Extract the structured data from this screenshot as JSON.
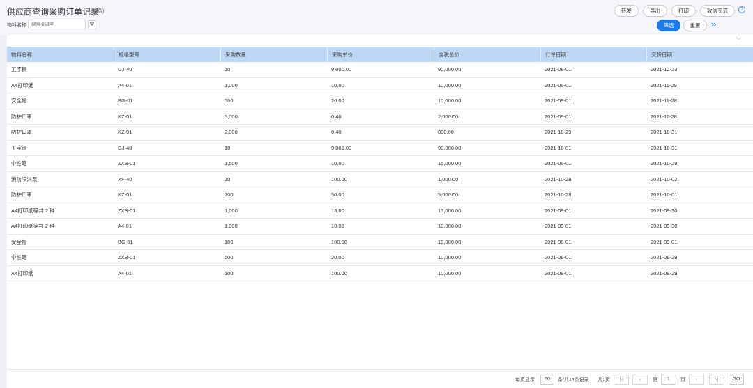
{
  "header": {
    "title": "供应商查询采购订单记录",
    "count": "(14条)",
    "filter_label": "物料名称",
    "search_placeholder": "搜索关键字",
    "empty_label": "空"
  },
  "actions": {
    "forward": "转发",
    "export": "导出",
    "print": "打印",
    "message": "致信交流",
    "help": "?",
    "filter": "筛选",
    "reset": "重置",
    "expand": "»",
    "collapse": "⌵"
  },
  "table": {
    "columns": [
      "物料名称",
      "规格型号",
      "采购数量",
      "采购单价",
      "含税总价",
      "订单日期",
      "交货日期"
    ],
    "rows": [
      [
        "工字钢",
        "GJ-40",
        "10",
        "9,000.00",
        "90,000.00",
        "2021-08-01",
        "2021-12-23"
      ],
      [
        "A4打印纸",
        "A4-01",
        "1,000",
        "10.00",
        "10,000.00",
        "2021-09-01",
        "2021-11-29"
      ],
      [
        "安全帽",
        "BG-01",
        "500",
        "20.00",
        "10,000.00",
        "2021-09-01",
        "2021-11-28"
      ],
      [
        "防护口罩",
        "KZ-01",
        "5,000",
        "0.40",
        "2,000.00",
        "2021-09-01",
        "2021-11-28"
      ],
      [
        "防护口罩",
        "KZ-01",
        "2,000",
        "0.40",
        "800.00",
        "2021-10-29",
        "2021-10-31"
      ],
      [
        "工字钢",
        "GJ-40",
        "10",
        "9,000.00",
        "90,000.00",
        "2021-10-01",
        "2021-10-31"
      ],
      [
        "中性笔",
        "ZXB-01",
        "1,500",
        "10.00",
        "15,000.00",
        "2021-09-01",
        "2021-10-29"
      ],
      [
        "消防喷淋泵",
        "XF-40",
        "10",
        "100.00",
        "1,000.00",
        "2021-10-28",
        "2021-10-02"
      ],
      [
        "防护口罩",
        "KZ-01",
        "100",
        "50.00",
        "5,000.00",
        "2021-10-28",
        "2021-10-01"
      ],
      [
        "A4打印纸等共 2 种",
        "ZXB-01",
        "1,000",
        "13.00",
        "13,000.00",
        "2021-09-01",
        "2021-09-30"
      ],
      [
        "A4打印纸等共 2 种",
        "A4-01",
        "1,000",
        "10.00",
        "10,000.00",
        "2021-09-01",
        "2021-09-30"
      ],
      [
        "安全帽",
        "BG-01",
        "100",
        "100.00",
        "10,000.00",
        "2021-08-01",
        "2021-09-01"
      ],
      [
        "中性笔",
        "ZXB-01",
        "500",
        "20.00",
        "10,000.00",
        "2021-08-01",
        "2021-08-29"
      ],
      [
        "A4打印纸",
        "A4-01",
        "100",
        "100.00",
        "10,000.00",
        "2021-08-01",
        "2021-08-29"
      ]
    ]
  },
  "pagination": {
    "per_page_label": "每页显示",
    "per_page": "50",
    "summary": "条/共14条记录",
    "total_pages": "共1页",
    "page_prefix": "第",
    "current_page": "1",
    "page_suffix": "页",
    "go": "GO",
    "first": "|‹",
    "prev": "‹",
    "next": "›",
    "last": "›|"
  }
}
